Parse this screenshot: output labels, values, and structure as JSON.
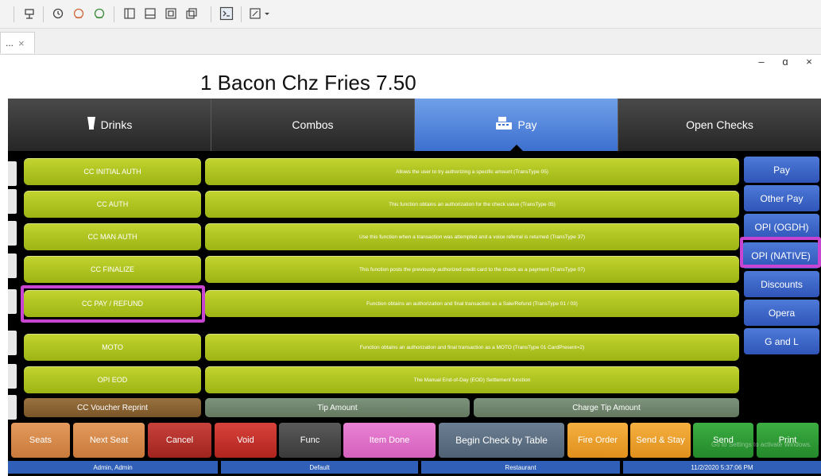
{
  "toolbar": {
    "icons": [
      "plug-icon",
      "history-icon",
      "alert-icon",
      "sync-icon",
      "panel-left-icon",
      "panel-bottom-icon",
      "fit-screen-icon",
      "window-icon",
      "terminal-icon",
      "expand-icon"
    ]
  },
  "session_tab": {
    "label": "...",
    "close": "×"
  },
  "window_controls": {
    "minimize": "–",
    "restore": "ɑ",
    "close": "×"
  },
  "receipt": {
    "line": "1 Bacon Chz Fries 7.50"
  },
  "categories": [
    {
      "label": "Drinks",
      "icon": "cup-icon"
    },
    {
      "label": "Combos"
    },
    {
      "label": "Pay",
      "icon": "cash-register-icon",
      "active": true
    },
    {
      "label": "Open Checks"
    }
  ],
  "functions": [
    {
      "name": "CC INITIAL AUTH",
      "desc": "Allows the user to try authorizing a specific amount (TransType 05)"
    },
    {
      "name": "CC AUTH",
      "desc": "This function obtains an authorization for the check value (TransType 05)"
    },
    {
      "name": "CC  MAN AUTH",
      "desc": "Use this function when a transaction was attempted and a voice referral is returned (TransType 37)"
    },
    {
      "name": "CC FINALIZE",
      "desc": "This function posts the previously-authorized credit card to the check as a payment (TransType 07)"
    },
    {
      "name": "CC PAY / REFUND",
      "desc": "Function obtains an authorization and final transaction as a Sale/Refund (TransType 01 / 03)",
      "highlighted": true
    },
    {
      "name": "MOTO",
      "desc": "Function obtains an authorization and final transaction as a MOTO (TransType 01 CardPresent=2)"
    },
    {
      "name": "OPI EOD",
      "desc": "The Manual End-of-Day (EOD) Settlement function"
    }
  ],
  "side_menu": [
    {
      "label": "Pay"
    },
    {
      "label": "Other Pay"
    },
    {
      "label": "OPI (OGDH)"
    },
    {
      "label": "OPI (NATIVE)",
      "highlighted": true
    },
    {
      "label": "Discounts"
    },
    {
      "label": "Opera"
    },
    {
      "label": "G and L"
    }
  ],
  "tip_row": {
    "voucher": "CC Voucher Reprint",
    "tip_amount": "Tip Amount",
    "charge_tip": "Charge Tip Amount"
  },
  "actions": [
    {
      "label": "Seats",
      "color": "#d98a48"
    },
    {
      "label": "Next Seat",
      "color": "#d98a48"
    },
    {
      "label": "Cancel",
      "color": "#b8322c"
    },
    {
      "label": "Void",
      "color": "#c8322c"
    },
    {
      "label": "Func",
      "color": "#4b4b4b"
    },
    {
      "label": "Item Done",
      "color": "#e070c8"
    },
    {
      "label": "Begin Check by Table",
      "color": "#5b6e82"
    },
    {
      "label": "Fire Order",
      "color": "#f0a02a"
    },
    {
      "label": "Send & Stay",
      "color": "#f0a02a"
    },
    {
      "label": "Send",
      "color": "#2e9a34"
    },
    {
      "label": "Print",
      "color": "#2e9a34"
    }
  ],
  "status": {
    "user": "Admin, Admin",
    "profile": "Default",
    "revenue_center": "Restaurant",
    "datetime": "11/2/2020 5:37:06 PM"
  },
  "watermark": "Go to Settings to activate Windows."
}
